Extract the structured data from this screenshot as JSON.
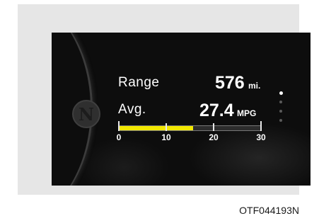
{
  "display": {
    "mode_icon_letter": "N",
    "range": {
      "label": "Range",
      "value": "576",
      "unit": "mi."
    },
    "average": {
      "label": "Avg.",
      "value": "27.4",
      "unit": "MPG"
    },
    "gauge": {
      "fill_fraction": 0.52,
      "ticks": [
        "0",
        "10",
        "20",
        "30"
      ],
      "fill_color": "#f2e800"
    },
    "page_indicator": {
      "total": 4,
      "active_index": 0
    }
  },
  "caption": "OTF044193N"
}
